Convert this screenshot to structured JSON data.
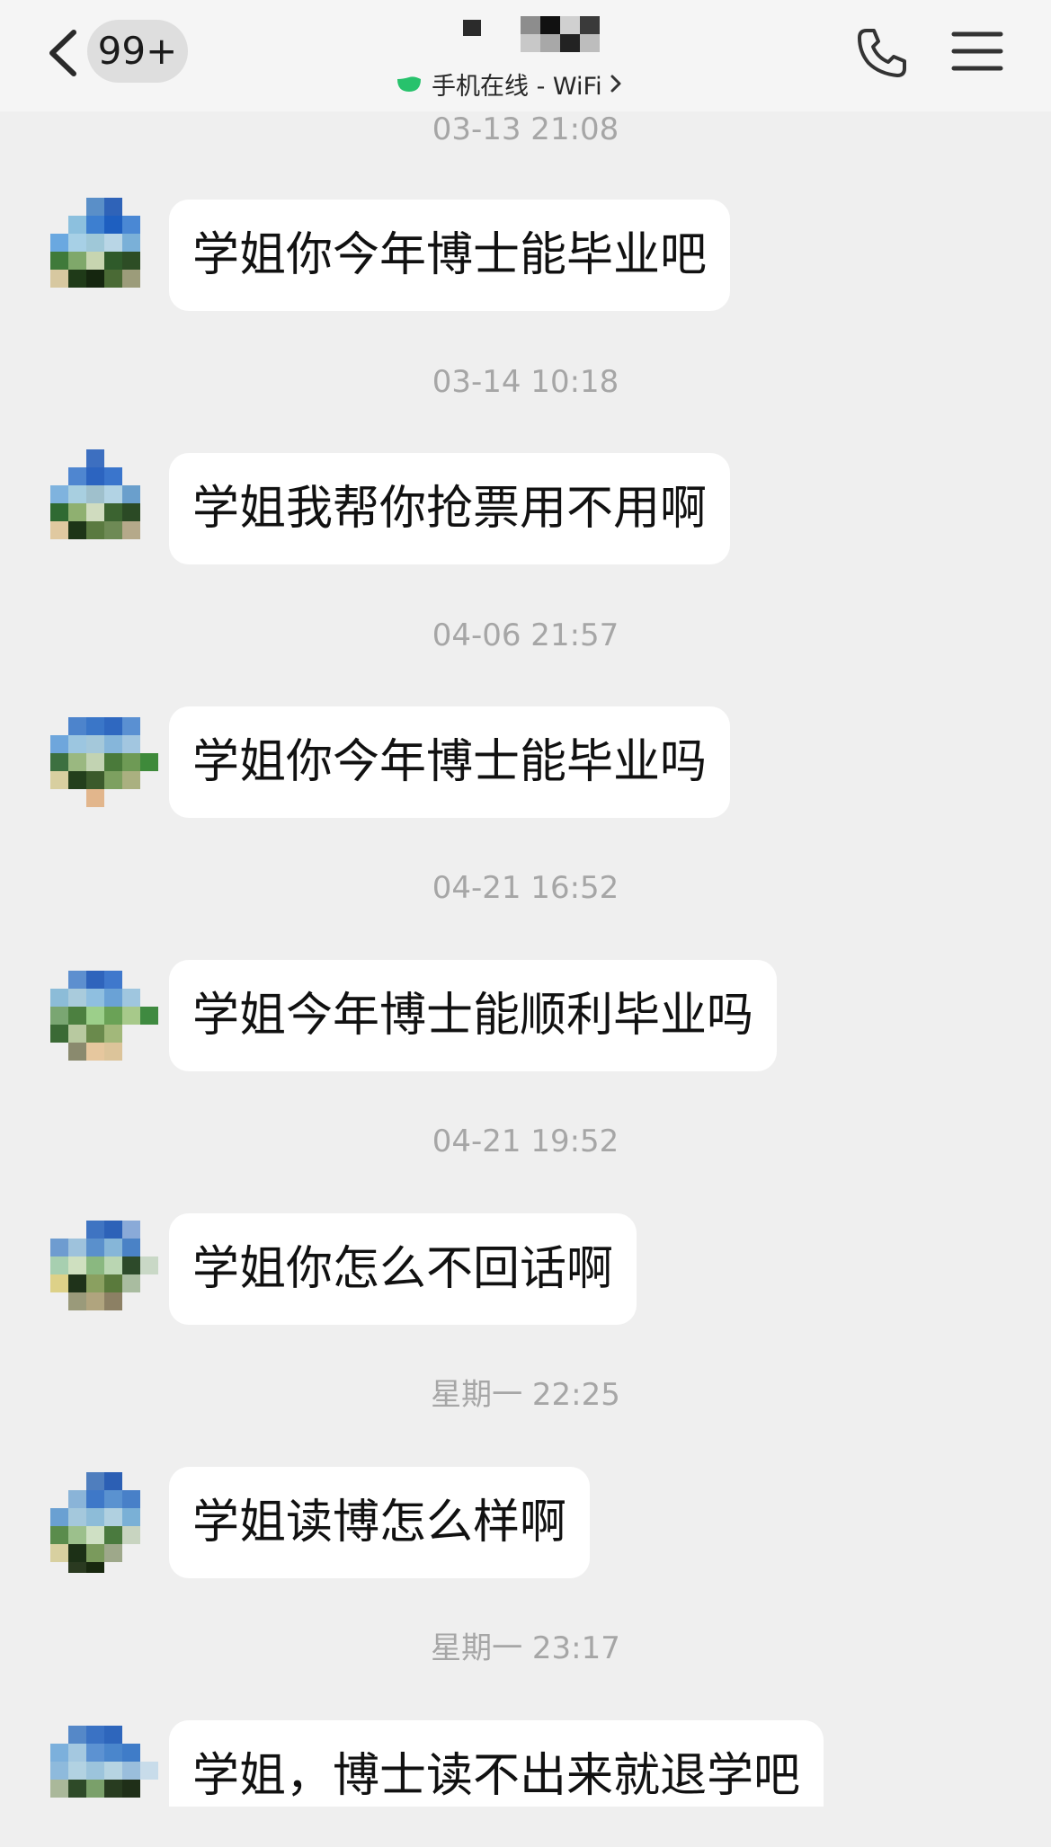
{
  "header": {
    "unread_badge": "99+",
    "status_text": "手机在线 - WiFi",
    "status_color": "#2ecc71",
    "icons": {
      "back": "chevron-left-icon",
      "phone": "phone-icon",
      "menu": "hamburger-menu-icon"
    }
  },
  "messages": [
    {
      "timestamp": "03-13 21:08",
      "text": "学姐你今年博士能毕业吧"
    },
    {
      "timestamp": "03-14 10:18",
      "text": "学姐我帮你抢票用不用啊"
    },
    {
      "timestamp": "04-06 21:57",
      "text": "学姐你今年博士能毕业吗"
    },
    {
      "timestamp": "04-21 16:52",
      "text": "学姐今年博士能顺利毕业吗"
    },
    {
      "timestamp": "04-21 19:52",
      "text": "学姐你怎么不回话啊"
    },
    {
      "timestamp": "星期一 22:25",
      "text": "学姐读博怎么样啊"
    },
    {
      "timestamp": "星期一 23:17",
      "text": "学姐，博士读不出来就退学吧"
    }
  ],
  "colors": {
    "background": "#efefef",
    "header_background": "#f5f5f5",
    "bubble": "#ffffff",
    "timestamp_text": "#a6a6a6",
    "message_text": "#111111"
  }
}
